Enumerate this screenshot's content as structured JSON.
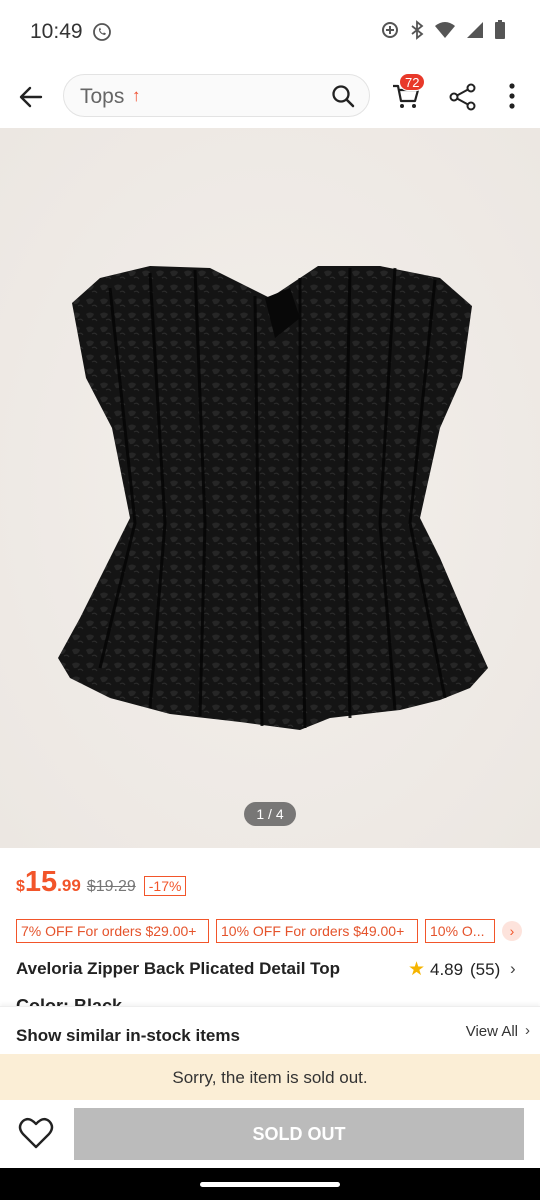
{
  "status_bar": {
    "time": "10:49",
    "left_icon": "whatsapp-icon",
    "right_icons": [
      "data-saver-icon",
      "bluetooth-icon",
      "wifi-icon",
      "signal-icon",
      "battery-icon"
    ]
  },
  "top_nav": {
    "search_text": "Tops",
    "search_trend_icon": "arrow-up-icon",
    "cart_count": "72",
    "icons": [
      "back-arrow-icon",
      "search-icon",
      "cart-icon",
      "share-icon",
      "more-vert-icon"
    ]
  },
  "gallery": {
    "page_indicator": "1 / 4",
    "image_subject": "black strapless pleated top"
  },
  "price": {
    "currency": "$",
    "integer": "15",
    "decimal": ".99",
    "original": "$19.29",
    "discount": "-17%",
    "color": "#f2552a"
  },
  "coupons": [
    "7% OFF For orders $29.00+",
    "10% OFF For orders $49.00+",
    "10% O..."
  ],
  "product": {
    "title": "Aveloria Zipper Back Plicated Detail Top",
    "rating": "4.89",
    "review_count": "(55)",
    "color_label_peek": "Color: Black"
  },
  "similar": {
    "label": "Show similar in-stock items",
    "view_all": "View All"
  },
  "sold_out": {
    "banner": "Sorry, the item is sold out.",
    "button": "SOLD OUT"
  },
  "colors": {
    "accent": "#f2552a",
    "banner_bg": "#fbeed6",
    "button_disabled": "#bbbbbb"
  }
}
